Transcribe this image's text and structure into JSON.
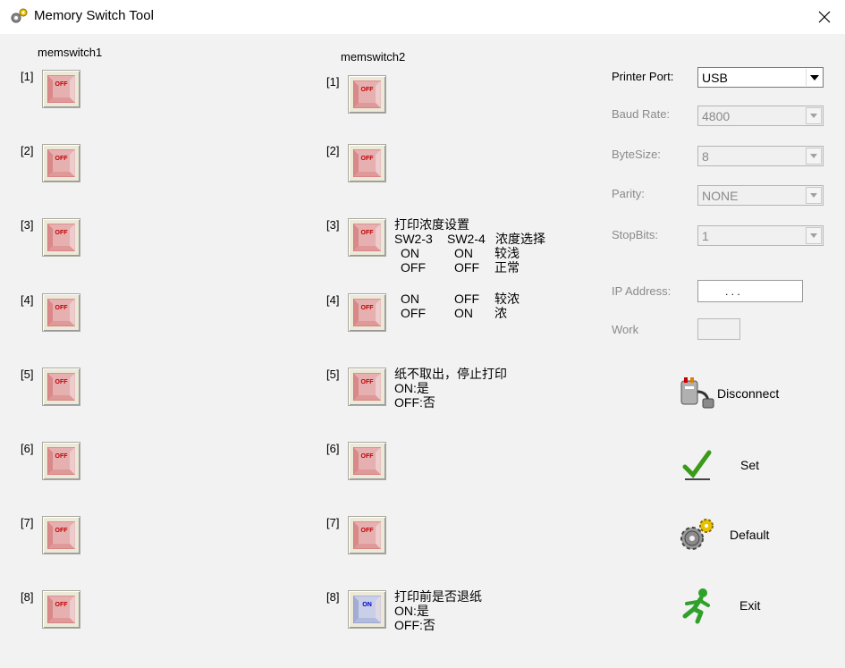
{
  "window": {
    "title": "Memory Switch Tool",
    "close_glyph": "✕"
  },
  "groups": {
    "memswitch1": "memswitch1",
    "memswitch2": "memswitch2"
  },
  "switch_labels": {
    "off": "OFF",
    "on": "ON"
  },
  "memswitch1": [
    {
      "index": "[1]",
      "state": "off"
    },
    {
      "index": "[2]",
      "state": "off"
    },
    {
      "index": "[3]",
      "state": "off"
    },
    {
      "index": "[4]",
      "state": "off"
    },
    {
      "index": "[5]",
      "state": "off"
    },
    {
      "index": "[6]",
      "state": "off"
    },
    {
      "index": "[7]",
      "state": "off"
    },
    {
      "index": "[8]",
      "state": "off"
    }
  ],
  "memswitch2": [
    {
      "index": "[1]",
      "state": "off"
    },
    {
      "index": "[2]",
      "state": "off"
    },
    {
      "index": "[3]",
      "state": "off"
    },
    {
      "index": "[4]",
      "state": "off"
    },
    {
      "index": "[5]",
      "state": "off"
    },
    {
      "index": "[6]",
      "state": "off"
    },
    {
      "index": "[7]",
      "state": "off"
    },
    {
      "index": "[8]",
      "state": "on"
    }
  ],
  "descriptions": {
    "density": {
      "title": "打印浓度设置",
      "headers": [
        "SW2-3",
        "SW2-4",
        "浓度选择"
      ],
      "rows": [
        [
          "ON",
          "ON",
          "较浅"
        ],
        [
          "OFF",
          "OFF",
          "正常"
        ],
        [
          "ON",
          "OFF",
          "较浓"
        ],
        [
          "OFF",
          "ON",
          "浓"
        ]
      ]
    },
    "sw5": {
      "title": "纸不取出，停止打印",
      "on": "ON:是",
      "off": "OFF:否"
    },
    "sw8": {
      "title": "打印前是否退纸",
      "on": "ON:是",
      "off": "OFF:否"
    }
  },
  "settings": {
    "printer_port": {
      "label": "Printer Port:",
      "value": "USB"
    },
    "baud_rate": {
      "label": "Baud Rate:",
      "value": "4800"
    },
    "byte_size": {
      "label": "ByteSize:",
      "value": "8"
    },
    "parity": {
      "label": "Parity:",
      "value": "NONE"
    },
    "stop_bits": {
      "label": "StopBits:",
      "value": "1"
    },
    "ip_address": {
      "label": "IP Address:",
      "value": ".   .   ."
    },
    "work": {
      "label": "Work",
      "value": ""
    }
  },
  "actions": {
    "disconnect": "Disconnect",
    "set": "Set",
    "default": "Default",
    "exit": "Exit"
  },
  "colors": {
    "off_text": "#c00000",
    "on_text": "#0000c0",
    "disabled_text": "#8a8a8a"
  }
}
